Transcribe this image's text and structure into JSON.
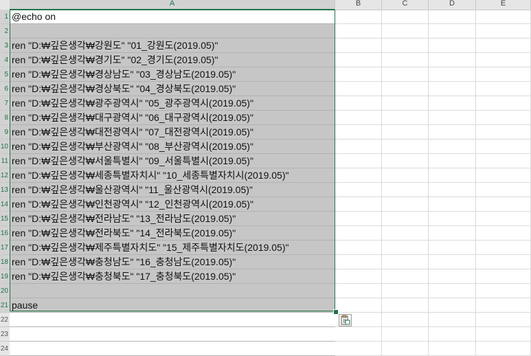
{
  "column_headers": [
    "A",
    "B",
    "C",
    "D",
    "E"
  ],
  "row_numbers": [
    "1",
    "2",
    "3",
    "4",
    "5",
    "6",
    "7",
    "8",
    "9",
    "10",
    "11",
    "12",
    "13",
    "14",
    "15",
    "16",
    "17",
    "18",
    "19",
    "20",
    "21",
    "22",
    "23",
    "24"
  ],
  "cells_a": [
    "@echo on",
    "",
    "ren \"D:₩깊은생각₩강원도\" \"01_강원도(2019.05)\"",
    "ren \"D:₩깊은생각₩경기도\" \"02_경기도(2019.05)\"",
    "ren \"D:₩깊은생각₩경상남도\" \"03_경상남도(2019.05)\"",
    "ren \"D:₩깊은생각₩경상북도\" \"04_경상북도(2019.05)\"",
    "ren \"D:₩깊은생각₩광주광역시\" \"05_광주광역시(2019.05)\"",
    "ren \"D:₩깊은생각₩대구광역시\" \"06_대구광역시(2019.05)\"",
    "ren \"D:₩깊은생각₩대전광역시\" \"07_대전광역시(2019.05)\"",
    "ren \"D:₩깊은생각₩부산광역시\" \"08_부산광역시(2019.05)\"",
    "ren \"D:₩깊은생각₩서울특별시\" \"09_서울특별시(2019.05)\"",
    "ren \"D:₩깊은생각₩세종특별자치시\" \"10_세종특별자치시(2019.05)\"",
    "ren \"D:₩깊은생각₩울산광역시\" \"11_울산광역시(2019.05)\"",
    "ren \"D:₩깊은생각₩인천광역시\" \"12_인천광역시(2019.05)\"",
    "ren \"D:₩깊은생각₩전라남도\" \"13_전라남도(2019.05)\"",
    "ren \"D:₩깊은생각₩전라북도\" \"14_전라북도(2019.05)\"",
    "ren \"D:₩깊은생각₩제주특별자치도\" \"15_제주특별자치도(2019.05)\"",
    "ren \"D:₩깊은생각₩충청남도\" \"16_충청남도(2019.05)\"",
    "ren \"D:₩깊은생각₩충청북도\" \"17_충청북도(2019.05)\"",
    "",
    "pause",
    "",
    "",
    ""
  ],
  "selection_color": "#217346",
  "paste_options_icon": "clipboard-icon"
}
